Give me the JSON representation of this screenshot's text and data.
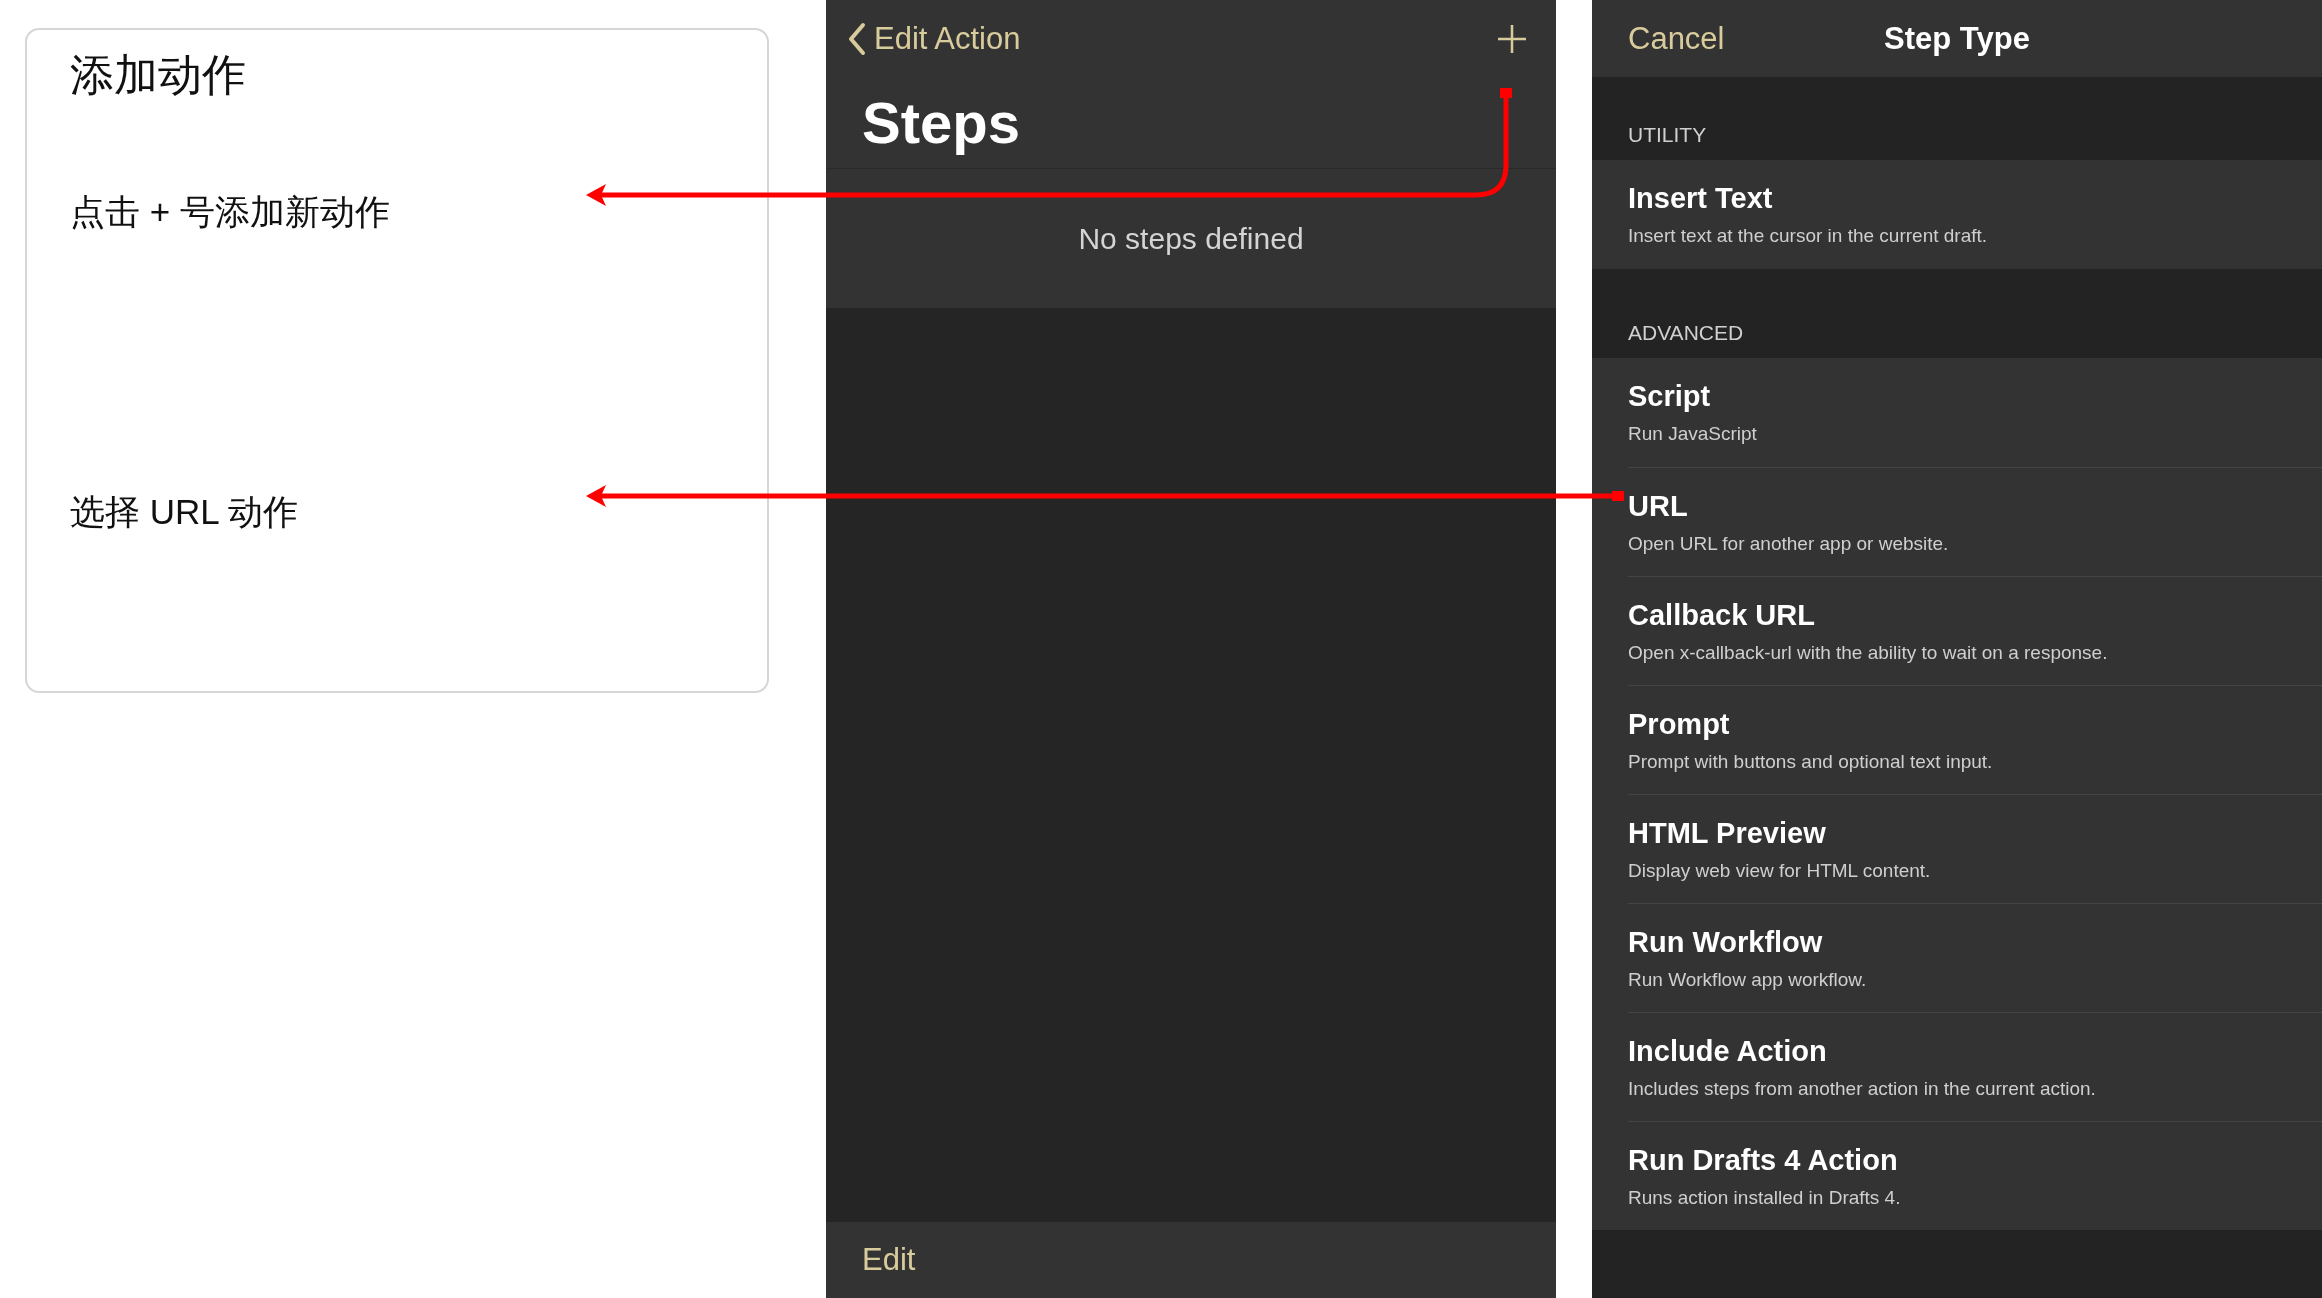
{
  "annotation_card": {
    "title": "添加动作",
    "notes": [
      {
        "text": "点击 + 号添加新动作"
      },
      {
        "text": "选择 URL 动作"
      }
    ]
  },
  "edit_action_screen": {
    "back_button": "Edit Action",
    "title": "Steps",
    "empty_message": "No steps defined",
    "toolbar": {
      "edit_button": "Edit"
    }
  },
  "step_type_screen": {
    "cancel_button": "Cancel",
    "title": "Step Type",
    "sections": [
      {
        "header": "UTILITY",
        "items": [
          {
            "title": "Insert Text",
            "description": "Insert text at the cursor in the current draft."
          }
        ]
      },
      {
        "header": "ADVANCED",
        "items": [
          {
            "title": "Script",
            "description": "Run JavaScript"
          },
          {
            "title": "URL",
            "description": "Open URL for another app or website."
          },
          {
            "title": "Callback URL",
            "description": "Open x-callback-url with the ability to wait on a response."
          },
          {
            "title": "Prompt",
            "description": "Prompt with buttons and optional text input."
          },
          {
            "title": "HTML Preview",
            "description": "Display web view for HTML content."
          },
          {
            "title": "Run Workflow",
            "description": "Run Workflow app workflow."
          },
          {
            "title": "Include Action",
            "description": "Includes steps from another action in the current action."
          },
          {
            "title": "Run Drafts 4 Action",
            "description": "Runs action installed in Drafts 4."
          }
        ]
      }
    ]
  }
}
